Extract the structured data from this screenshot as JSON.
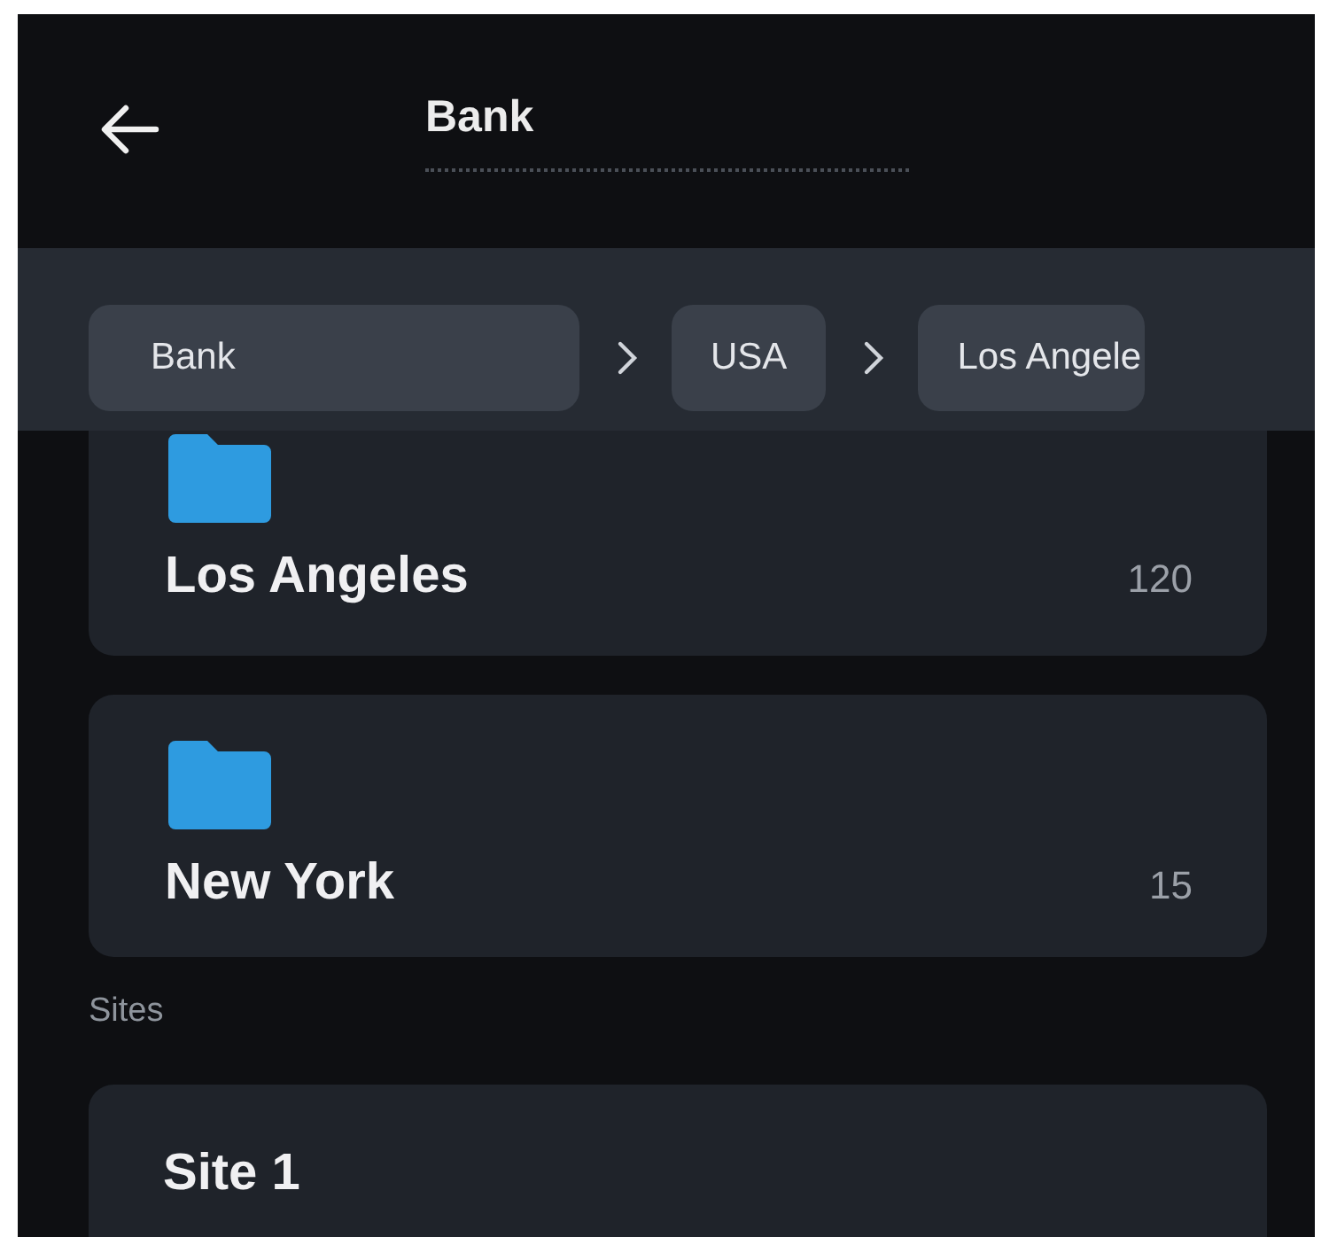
{
  "header": {
    "title": "Bank"
  },
  "breadcrumbs": [
    {
      "label": "Bank"
    },
    {
      "label": "USA"
    },
    {
      "label": "Los Angele"
    }
  ],
  "folders": [
    {
      "name": "Los Angeles",
      "count": "120"
    },
    {
      "name": "New York",
      "count": "15"
    }
  ],
  "sites_section": {
    "heading": "Sites",
    "items": [
      {
        "name": "Site 1"
      }
    ]
  }
}
